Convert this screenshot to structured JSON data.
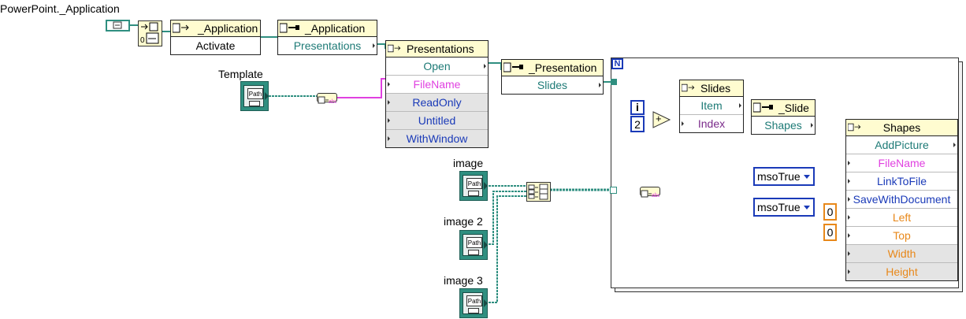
{
  "labels": {
    "app_class": "PowerPoint._Application",
    "template": "Template",
    "image1": "image",
    "image2": "image 2",
    "image3": "image 3"
  },
  "nodes": {
    "activate": {
      "header": "_Application",
      "rows": [
        "Activate"
      ]
    },
    "app_prop": {
      "header": "_Application",
      "rows": [
        "Presentations"
      ]
    },
    "presentations": {
      "header": "Presentations",
      "rows": [
        "Open",
        "FileName",
        "ReadOnly",
        "Untitled",
        "WithWindow"
      ]
    },
    "presentation_prop": {
      "header": "_Presentation",
      "rows": [
        "Slides"
      ]
    },
    "slides": {
      "header": "Slides",
      "rows": [
        "Item",
        "Index"
      ]
    },
    "slide_prop": {
      "header": "_Slide",
      "rows": [
        "Shapes"
      ]
    },
    "shapes": {
      "header": "Shapes",
      "rows": [
        "AddPicture",
        "FileName",
        "LinkToFile",
        "SaveWithDocument",
        "Left",
        "Top",
        "Width",
        "Height"
      ]
    }
  },
  "path_controls": {
    "text": "Path"
  },
  "loop": {
    "count_label": "N",
    "iteration_label": "i"
  },
  "constants": {
    "two": "2",
    "add_symbol": "+",
    "zero_left": "0",
    "zero_top": "0"
  },
  "rings": {
    "link_to_file": "msoTrue",
    "save_with_document": "msoTrue"
  },
  "colors": {
    "refnum_wire": "#2f8f80",
    "string_wire": "#e040e0",
    "numeric_int_wire": "#1a3ab8",
    "numeric_orange": "#e8881a",
    "property_header": "#fffcd0"
  }
}
